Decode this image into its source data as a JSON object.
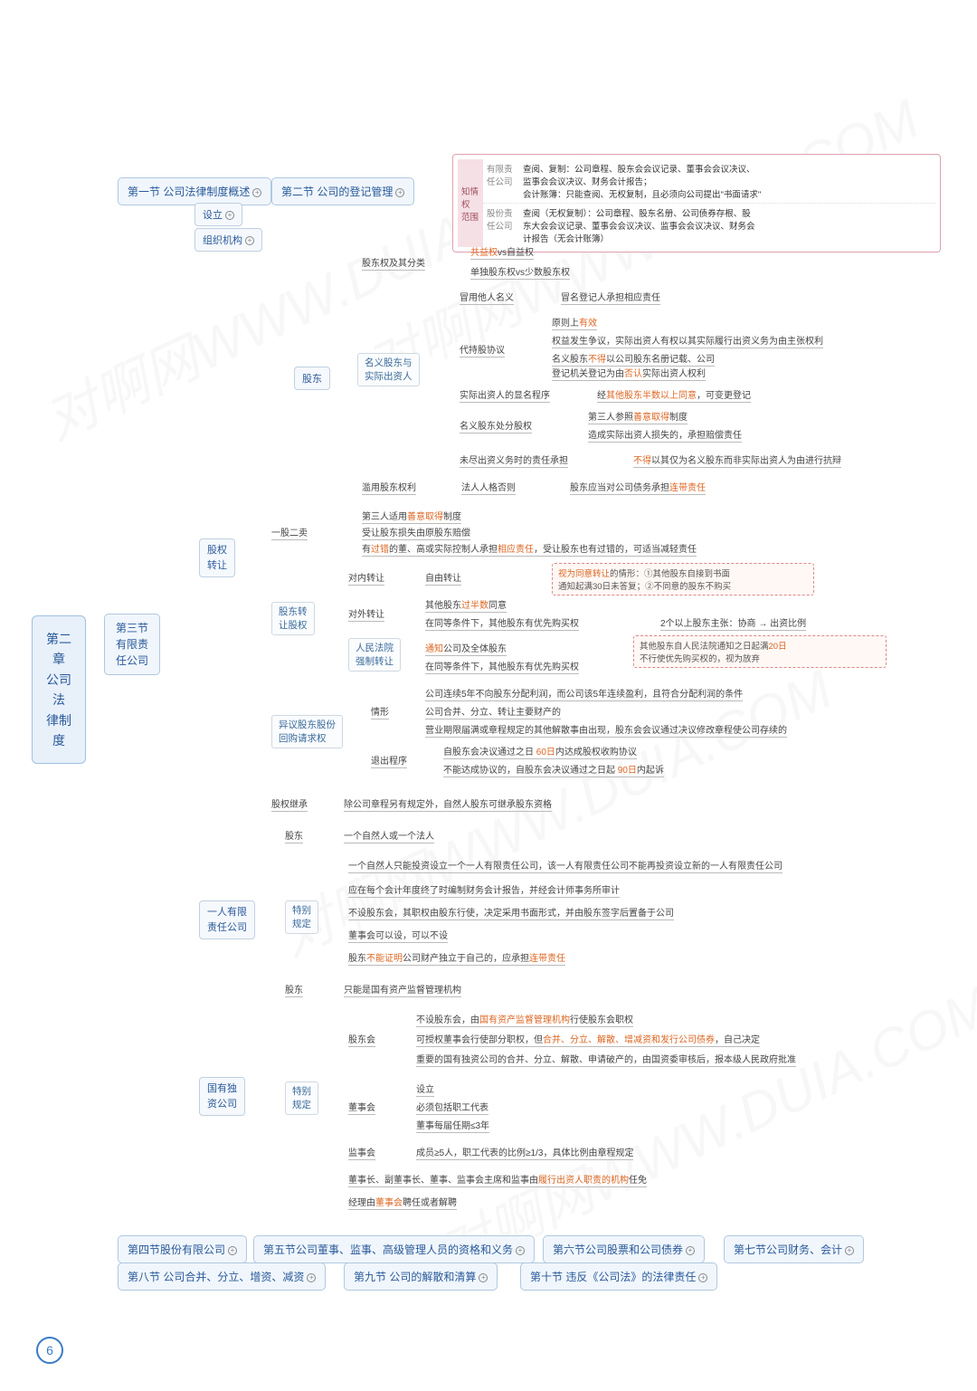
{
  "page_number": "6",
  "watermark": "对啊网WWW.DUIA.COM",
  "root": {
    "title": "第二章\n公司法\n律制度"
  },
  "sec1": {
    "label": "第一节 公司法律制度概述"
  },
  "sec2": {
    "label": "第二节 公司的登记管理"
  },
  "sec3": {
    "label": "第三节\n有限责\n任公司"
  },
  "sec4": {
    "label": "第四节股份有限公司"
  },
  "sec5": {
    "label": "第五节公司董事、监事、高级管理人员的资格和义务"
  },
  "sec6": {
    "label": "第六节公司股票和公司债券"
  },
  "sec7": {
    "label": "第七节公司财务、会计"
  },
  "sec8": {
    "label": "第八节 公司合并、分立、增资、减资"
  },
  "sec9": {
    "label": "第九节 公司的解散和清算"
  },
  "sec10": {
    "label": "第十节 违反《公司法》的法律责任"
  },
  "s3": {
    "n1": "设立",
    "n2": "组织机构",
    "n3": "股东",
    "n4": "股权\n转让",
    "n5": "一人有限\n责任公司",
    "n6": "国有独\n资公司",
    "sh_cls": "股东权及其分类",
    "sh_cls1_a": "共益权",
    "sh_cls1_b": "vs自益权",
    "sh_cls2": "单独股东权vs少数股东权",
    "mingyi": "名义股东与\n实际出资人",
    "jieyong": "冒用他人名义",
    "jieyong_r": "冒名登记人承担相应责任",
    "daichi": "代持股协议",
    "dc1_a": "原则上",
    "dc1_b": "有效",
    "dc2": "权益发生争议，实际出资人有权以其实际履行出资义务为由主张权利",
    "dc3_a": "名义股东",
    "dc3_b": "不得",
    "dc3_c": "以公司股东名册记载、公司",
    "dc3_d": "登记机关登记为由",
    "dc3_e": "否认",
    "dc3_f": "实际出资人权利",
    "xianming": "实际出资人的显名程序",
    "xianming_r_a": "经",
    "xianming_r_b": "其他股东半数以上同意",
    "xianming_r_c": "，可变更登记",
    "chufen": "名义股东处分股权",
    "cf1_a": "第三人参照",
    "cf1_b": "善意取得",
    "cf1_c": "制度",
    "cf2": "造成实际出资人损失的，承担赔偿责任",
    "weijin": "未尽出资义务时的责任承担",
    "weijin_r_a": "不得",
    "weijin_r_b": "以其仅为名义股东而非实际出资人为由进行抗辩",
    "lanyong": "滥用股东权利",
    "lanyong_m": "法人人格否则",
    "lanyong_r_a": "股东应当对公司债务承担",
    "lanyong_r_b": "连带责任",
    "yg2m": "一股二卖",
    "yg1_a": "第三人适用",
    "yg1_b": "善意取得",
    "yg1_c": "制度",
    "yg2": "受让股东损失由原股东赔偿",
    "yg3_a": "有",
    "yg3_b": "过错",
    "yg3_c": "的董、高或实际控制人承担",
    "yg3_d": "相应责任",
    "yg3_e": "，受让股东也有过错的，可适当减轻责任",
    "zr_q": "股东转\n让股权",
    "dn": "对内转让",
    "dn_r": "自由转让",
    "dw": "对外转让",
    "dw1_a": "其他股东",
    "dw1_b": "过半数",
    "dw1_c": "同意",
    "dw2": "在同等条件下，其他股东有优先购买权",
    "dw2_r": "2个以上股东主张：协商 → 出资比例",
    "note1_a": "视为同意转让",
    "note1_b": "的情形：①其他股东自接到书面\n通知起满30日未答复；②不同意的股东不购买",
    "qz": "人民法院\n强制转让",
    "qz1_a": "通知",
    "qz1_b": "公司及全体股东",
    "qz2": "在同等条件下，其他股东有优先购买权",
    "note2_a": "其他股东自人民法院通知之日起满",
    "note2_b": "20日",
    "note2_c": "\n不行使优先购买权的，视为放弃",
    "yy": "异议股东股份\n回购请求权",
    "qx": "情形",
    "qx1": "公司连续5年不向股东分配利润，而公司该5年连续盈利，且符合分配利润的条件",
    "qx2": "公司合并、分立、转让主要财产的",
    "qx3": "营业期限届满或章程规定的其他解散事由出现，股东会会议通过决议修改章程使公司存续的",
    "tc": "退出程序",
    "tc1_a": "自股东会决议通过之日",
    "tc1_b": "60日",
    "tc1_c": "内达成股权收购协议",
    "tc2_a": "不能达成协议的，自股东会决议通过之日起",
    "tc2_b": "90日",
    "tc2_c": "内起诉",
    "jcq": "股权继承",
    "jc": "除公司章程另有规定外，自然人股东可继承股东资格",
    "one_gd": "股东",
    "one_gd_r": "一个自然人或一个法人",
    "one_tb": "特别\n规定",
    "one1": "一个自然人只能投资设立一个一人有限责任公司，该一人有限责任公司不能再投资设立新的一人有限责任公司",
    "one2": "应在每个会计年度终了时编制财务会计报告，并经会计师事务所审计",
    "one3": "不设股东会，其职权由股东行使，决定采用书面形式，并由股东签字后置备于公司",
    "one4": "董事会可以设，可以不设",
    "one5_a": "股东",
    "one5_b": "不能证明",
    "one5_c": "公司财产独立于自己的，应承担",
    "one5_d": "连带责任",
    "gy_gd": "股东",
    "gy_gd_r": "只能是国有资产监督管理机构",
    "gy_tb": "特别\n规定",
    "gdh": "股东会",
    "gdh1_a": "不设股东会，由",
    "gdh1_b": "国有资产监督管理机构",
    "gdh1_c": "行使股东会职权",
    "gdh2_a": "可授权董事会行使部分职权，但",
    "gdh2_b": "合并、分立、解散、增减资和发行公司债券",
    "gdh2_c": "，自己决定",
    "gdh3": "重要的国有独资公司的合并、分立、解散、申请破产的，由国资委审核后，报本级人民政府批准",
    "dsh": "董事会",
    "dsh1": "设立",
    "dsh2": "必须包括职工代表",
    "dsh3": "董事每届任期≤3年",
    "jsh": "监事会",
    "jsh_r": "成员≥5人，职工代表的比例≥1/3，具体比例由章程规定",
    "rm_a": "董事长、副董事长、董事、监事会主席和监事由",
    "rm_b": "履行出资人职责的机构",
    "rm_c": "任免",
    "jl_a": "经理由",
    "jl_b": "董事会",
    "jl_c": "聘任或者解聘"
  },
  "info": {
    "scope": "知情权\n范围",
    "row1_l": "有限责\n任公司",
    "row1_t": "查阅、复制：公司章程、股东会会议记录、董事会会议决议、\n监事会会议决议、财务会计报告；\n会计账簿：只能查阅、无权复制，且必须向公司提出\"书面请求\"",
    "row2_l": "股份责\n任公司",
    "row2_t": "查阅（无权复制）：公司章程、股东名册、公司债券存根、股\n东大会会议记录、董事会会议决议、监事会会议决议、财务会\n计报告（无会计账簿）"
  }
}
